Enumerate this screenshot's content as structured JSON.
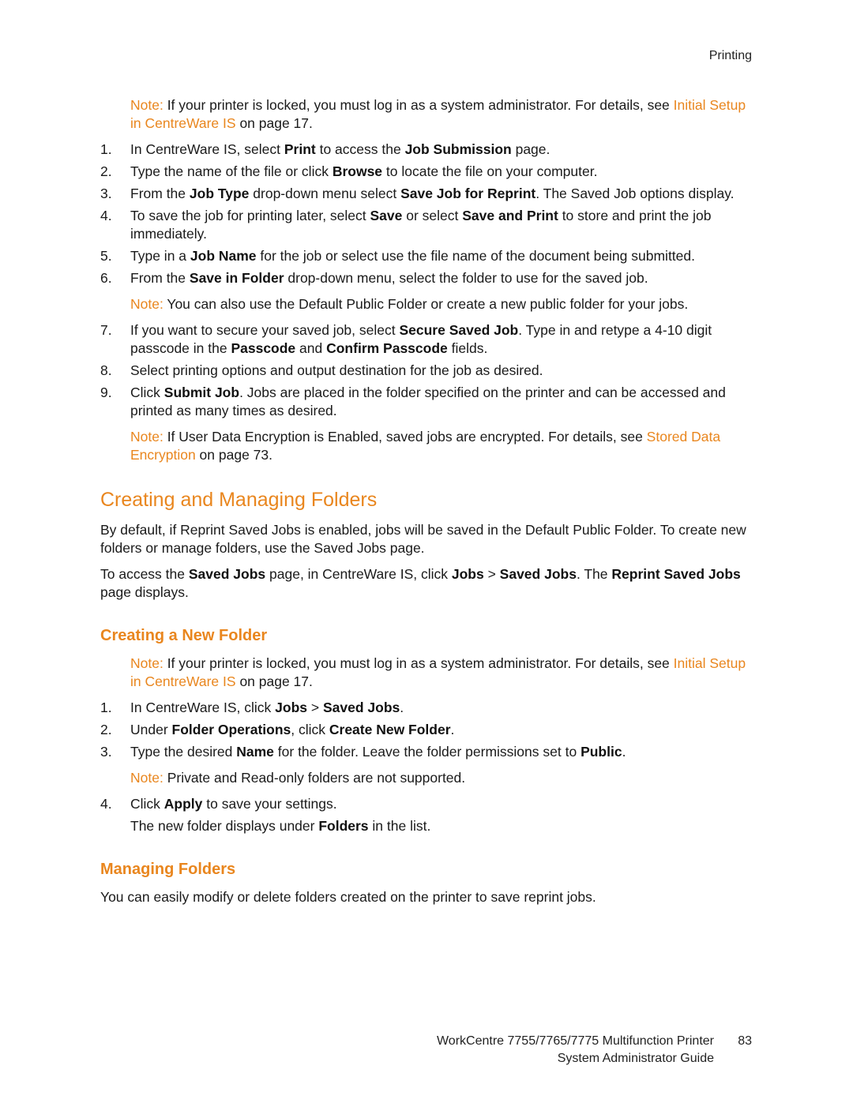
{
  "header": {
    "section": "Printing"
  },
  "top_note": {
    "label": "Note:",
    "text": " If your printer is locked, you must log in as a system administrator. For details, see ",
    "link": "Initial Setup in CentreWare IS",
    "suffix": " on page 17."
  },
  "steps_a": [
    {
      "num": "1.",
      "parts": [
        [
          "t",
          "In CentreWare IS, select "
        ],
        [
          "b",
          "Print"
        ],
        [
          "t",
          " to access the "
        ],
        [
          "b",
          "Job Submission"
        ],
        [
          "t",
          " page."
        ]
      ]
    },
    {
      "num": "2.",
      "parts": [
        [
          "t",
          "Type the name of the file or click "
        ],
        [
          "b",
          "Browse"
        ],
        [
          "t",
          " to locate the file on your computer."
        ]
      ]
    },
    {
      "num": "3.",
      "parts": [
        [
          "t",
          "From the "
        ],
        [
          "b",
          "Job Type"
        ],
        [
          "t",
          " drop-down menu select "
        ],
        [
          "b",
          "Save Job for Reprint"
        ],
        [
          "t",
          ". The Saved Job options display."
        ]
      ]
    },
    {
      "num": "4.",
      "parts": [
        [
          "t",
          "To save the job for printing later, select "
        ],
        [
          "b",
          "Save"
        ],
        [
          "t",
          " or select "
        ],
        [
          "b",
          "Save and Print"
        ],
        [
          "t",
          " to store and print the job immediately."
        ]
      ]
    },
    {
      "num": "5.",
      "parts": [
        [
          "t",
          "Type in a "
        ],
        [
          "b",
          "Job Name"
        ],
        [
          "t",
          " for the job or select use the file name of the document being submitted."
        ]
      ]
    },
    {
      "num": "6.",
      "parts": [
        [
          "t",
          "From the "
        ],
        [
          "b",
          "Save in Folder"
        ],
        [
          "t",
          " drop-down menu, select the folder to use for the saved job."
        ]
      ],
      "note": [
        [
          "o",
          "Note: "
        ],
        [
          "t",
          " You can also use the Default Public Folder or create a new public folder for your jobs."
        ]
      ]
    },
    {
      "num": "7.",
      "parts": [
        [
          "t",
          "If you want to secure your saved job, select "
        ],
        [
          "b",
          "Secure Saved Job"
        ],
        [
          "t",
          ". Type in and retype a 4-10 digit passcode in the "
        ],
        [
          "b",
          "Passcode"
        ],
        [
          "t",
          " and "
        ],
        [
          "b",
          "Confirm Passcode"
        ],
        [
          "t",
          " fields."
        ]
      ]
    },
    {
      "num": "8.",
      "parts": [
        [
          "t",
          "Select printing options and output destination for the job as desired."
        ]
      ]
    },
    {
      "num": "9.",
      "parts": [
        [
          "t",
          "Click "
        ],
        [
          "b",
          "Submit Job"
        ],
        [
          "t",
          ". Jobs are placed in the folder specified on the printer and can be accessed and printed as many times as desired."
        ]
      ],
      "note": [
        [
          "o",
          "Note:"
        ],
        [
          "t",
          " If User Data Encryption is Enabled, saved jobs are encrypted. For details, see "
        ],
        [
          "o",
          "Stored Data Encryption"
        ],
        [
          "t",
          " on page 73."
        ]
      ]
    }
  ],
  "section": {
    "title": "Creating and Managing Folders",
    "para1": "By default, if Reprint Saved Jobs is enabled, jobs will be saved in the Default Public Folder. To create new folders or manage folders, use the Saved Jobs page.",
    "para2": [
      [
        "t",
        "To access the "
      ],
      [
        "b",
        "Saved Jobs"
      ],
      [
        "t",
        " page, in CentreWare IS, click "
      ],
      [
        "b",
        "Jobs"
      ],
      [
        "t",
        " > "
      ],
      [
        "b",
        "Saved Jobs"
      ],
      [
        "t",
        ". The "
      ],
      [
        "b",
        "Reprint Saved Jobs"
      ],
      [
        "t",
        " page displays."
      ]
    ]
  },
  "create_folder": {
    "title": "Creating a New Folder",
    "note": {
      "label": "Note:",
      "text": " If your printer is locked, you must log in as a system administrator. For details, see ",
      "link": "Initial Setup in CentreWare IS",
      "suffix": " on page 17."
    },
    "steps": [
      {
        "num": "1.",
        "parts": [
          [
            "t",
            "In CentreWare IS, click "
          ],
          [
            "b",
            "Jobs"
          ],
          [
            "t",
            " > "
          ],
          [
            "b",
            "Saved Jobs"
          ],
          [
            "t",
            "."
          ]
        ]
      },
      {
        "num": "2.",
        "parts": [
          [
            "t",
            "Under "
          ],
          [
            "b",
            "Folder Operations"
          ],
          [
            "t",
            ", click "
          ],
          [
            "b",
            "Create New Folder"
          ],
          [
            "t",
            "."
          ]
        ]
      },
      {
        "num": "3.",
        "parts": [
          [
            "t",
            "Type the desired "
          ],
          [
            "b",
            "Name"
          ],
          [
            "t",
            " for the folder. Leave the folder permissions set to "
          ],
          [
            "b",
            "Public"
          ],
          [
            "t",
            "."
          ]
        ],
        "note": [
          [
            "o",
            "Note:"
          ],
          [
            "t",
            " Private and Read-only folders are not supported."
          ]
        ]
      },
      {
        "num": "4.",
        "parts": [
          [
            "t",
            "Click "
          ],
          [
            "b",
            "Apply"
          ],
          [
            "t",
            " to save your settings."
          ]
        ],
        "followup": [
          [
            "t",
            "The new folder displays under "
          ],
          [
            "b",
            "Folders"
          ],
          [
            "t",
            " in the list."
          ]
        ]
      }
    ]
  },
  "managing_folders": {
    "title": "Managing Folders",
    "text": "You can easily modify or delete folders created on the printer to save reprint jobs."
  },
  "footer": {
    "product": "WorkCentre 7755/7765/7775 Multifunction Printer",
    "page_number": "83",
    "guide": "System Administrator Guide"
  },
  "colors": {
    "accent": "#e9861e",
    "text": "#1a1a1a"
  }
}
